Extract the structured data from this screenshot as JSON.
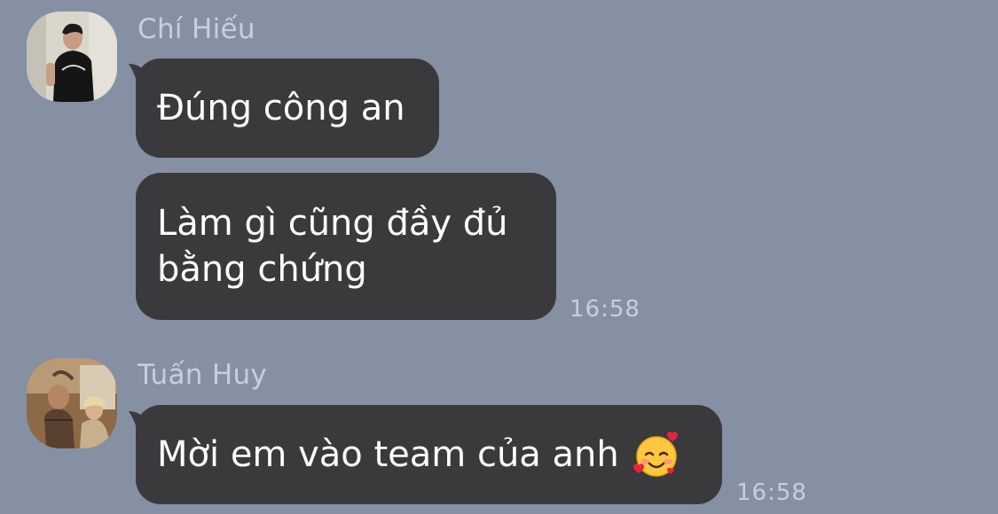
{
  "messages": [
    {
      "sender": "Chí Hiếu",
      "avatar_icon": "profile-photo-man-black-tshirt",
      "bubbles": [
        {
          "text": "Đúng công an",
          "time": ""
        },
        {
          "text": "Làm gì cũng đầy đủ\nbằng chứng",
          "time": "16:58"
        }
      ]
    },
    {
      "sender": "Tuấn Huy",
      "avatar_icon": "profile-photo-two-people",
      "bubbles": [
        {
          "text": "Mời em vào team của anh",
          "emoji": "smiling-face-with-hearts-emoji",
          "time": "16:58"
        }
      ]
    }
  ],
  "colors": {
    "background": "#8590A3",
    "bubble": "#3A3A3D",
    "bubble_text": "#FFFFFF",
    "meta_text": "#C9CFDA"
  }
}
